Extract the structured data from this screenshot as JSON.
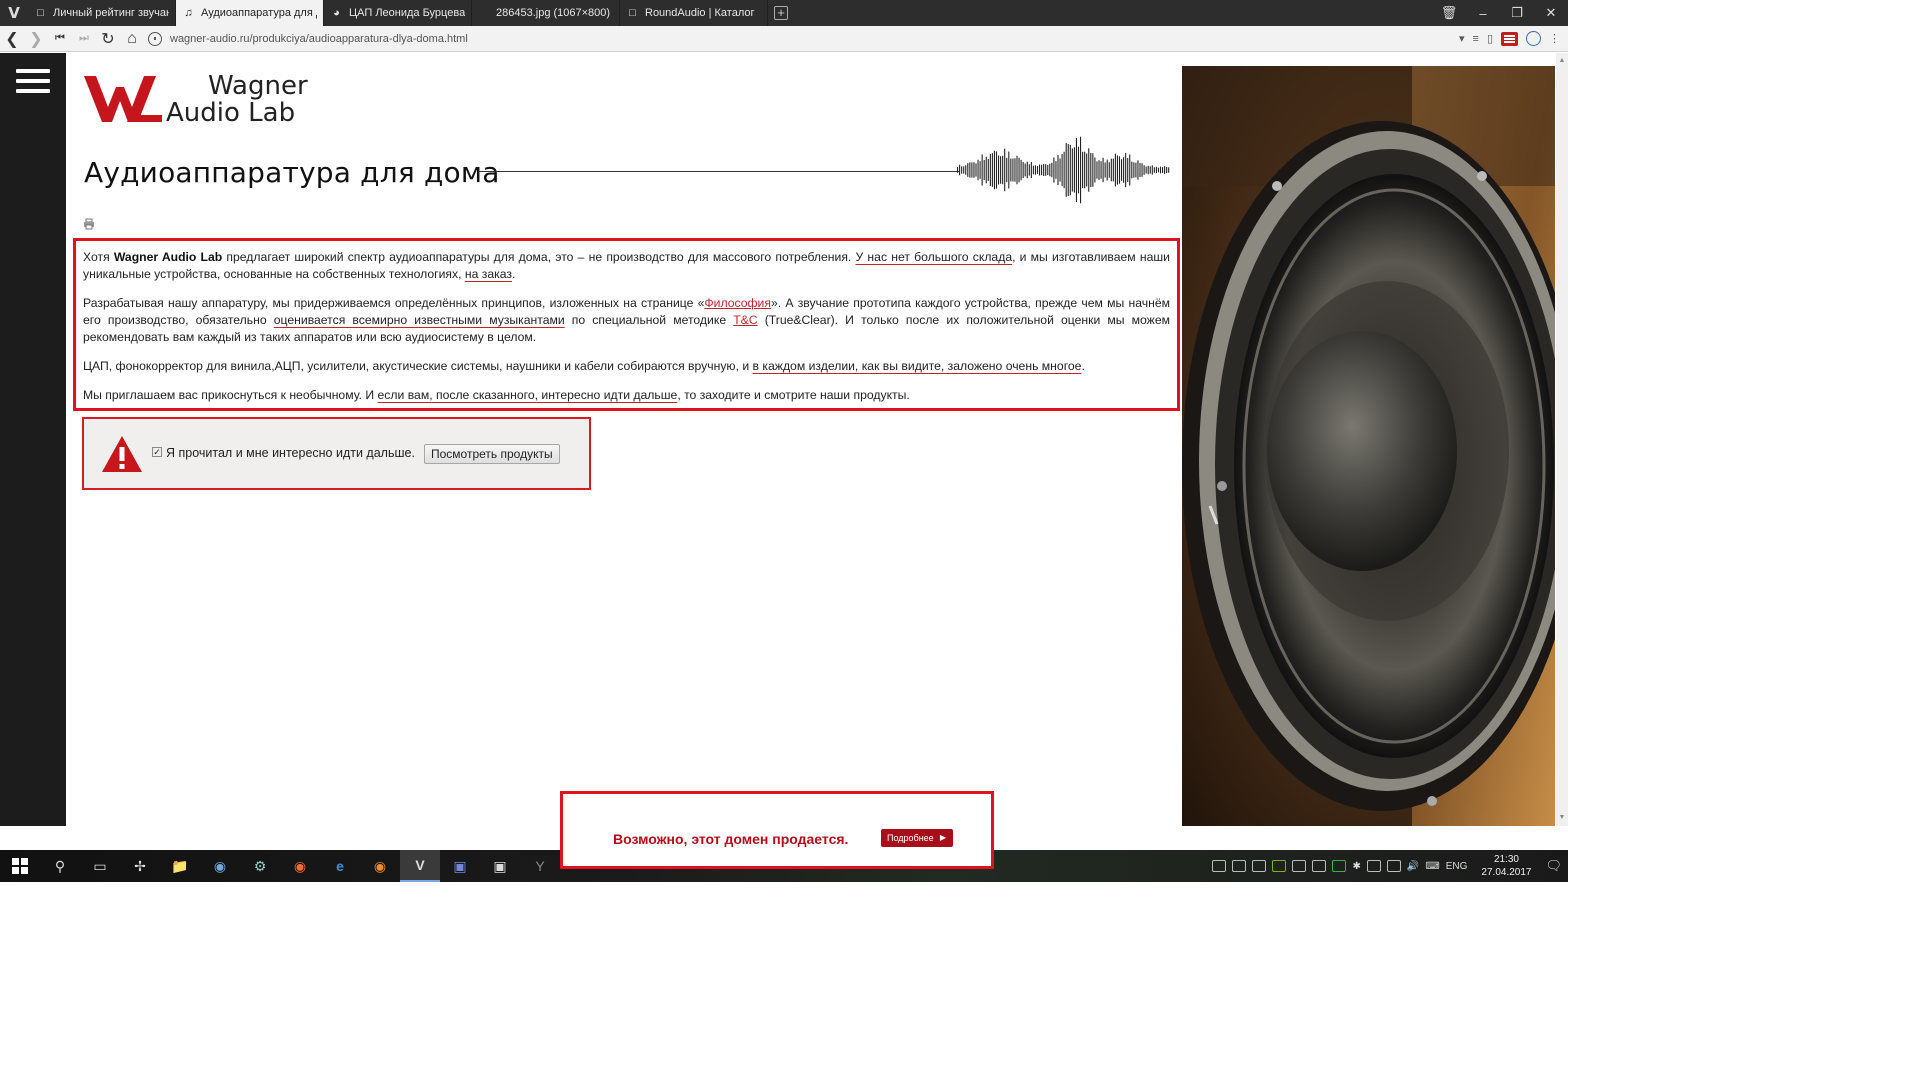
{
  "browser": {
    "tabs": [
      {
        "label": "Личный рейтинг звучания",
        "icon": "page-icon",
        "active": false
      },
      {
        "label": "Аудиоаппаратура для дома",
        "icon": "note-icon",
        "active": true
      },
      {
        "label": "ЦАП Леонида Бурцева - Ст",
        "icon": "globe-icon",
        "active": false
      },
      {
        "label": "286453.jpg (1067×800)",
        "icon": "",
        "active": false
      },
      {
        "label": "RoundAudio | Каталог",
        "icon": "page-icon",
        "active": false
      }
    ],
    "url": "wagner-audio.ru/produkciya/audioapparatura-dlya-doma.html"
  },
  "site": {
    "logo_line1": "Wagner",
    "logo_line2": "Audio Lab",
    "page_title": "Аудиоаппаратура для дома"
  },
  "content": {
    "p1_a": "Хотя ",
    "p1_brand": "Wagner Audio Lab",
    "p1_b": " предлагает широкий спектр аудиоаппаратуры для дома, это – не производство для массового потребления. ",
    "p1_u1": "У нас нет большого склада",
    "p1_c": ", и мы изготавливаем наши уникальные устройства, основанные на собственных технологиях, ",
    "p1_u2": "на заказ",
    "p1_d": ".",
    "p2_a": "Разрабатывая нашу аппаратуру, мы придерживаемся определённых принципов, изложенных на странице «",
    "p2_link1": "Философия",
    "p2_b": "». А звучание прототипа каждого устройства, прежде чем мы начнём его производство, обязательно ",
    "p2_u1": "оценивается всемирно известными музыкантами",
    "p2_c": " по специальной методике ",
    "p2_link2": "T&C",
    "p2_d": " (True&Clear). И только после их положительной оценки мы можем рекомендовать вам каждый из таких аппаратов или всю аудиосистему в целом.",
    "p3_a": "ЦАП, фонокорректор для винила,АЦП, усилители, акустические системы, наушники и кабели собираются вручную, и ",
    "p3_u1": "в каждом изделии, как вы видите, заложено очень многое",
    "p3_b": ".",
    "p4_a": "Мы приглашаем вас прикоснуться к необычному. И ",
    "p4_u1": "если вам, после сказанного, интересно идти дальше",
    "p4_b": ", то заходите и смотрите наши продукты."
  },
  "confirm": {
    "checked": true,
    "label": "Я прочитал и мне интересно идти дальше.",
    "button": "Посмотреть продукты"
  },
  "sale": {
    "text": "Возможно, этот домен продается.",
    "button": "Подробнее"
  },
  "taskbar": {
    "lang": "ENG",
    "time": "21:30",
    "date": "27.04.2017"
  },
  "colors": {
    "accent_red": "#e0121d",
    "link_red": "#c0252e",
    "rail": "#1c1c1c"
  }
}
